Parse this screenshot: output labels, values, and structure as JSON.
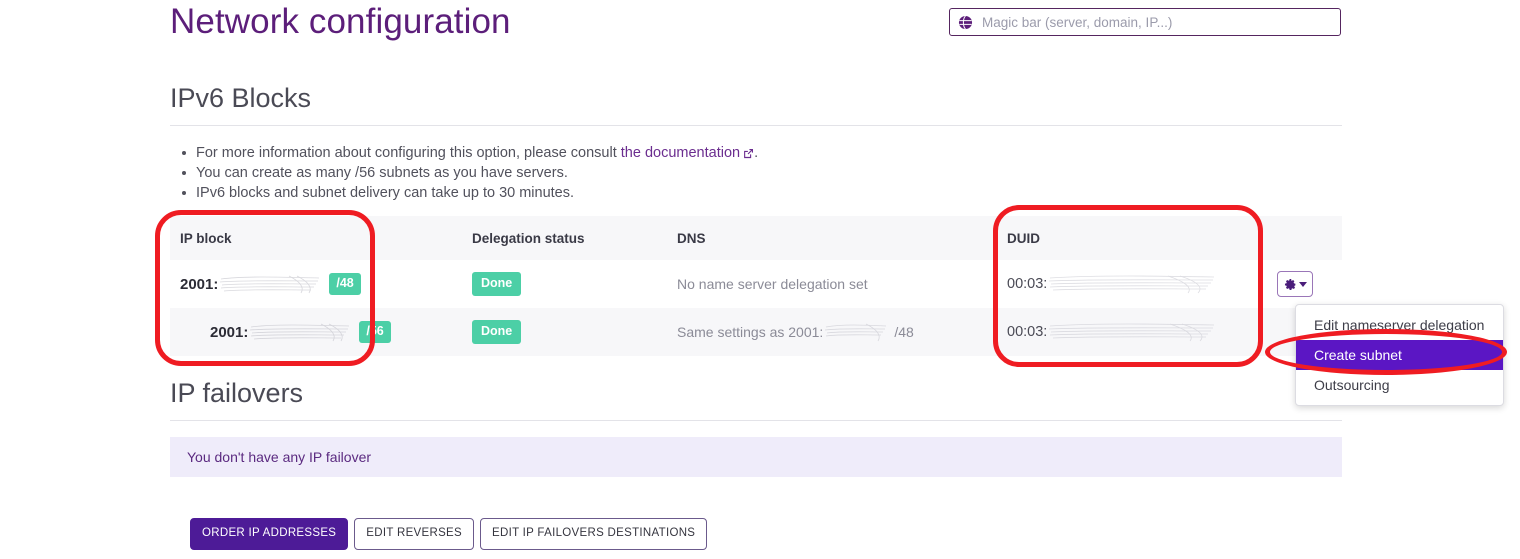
{
  "header": {
    "title": "Network configuration",
    "magicbar": {
      "placeholder": "Magic bar (server, domain, IP...)",
      "value": "",
      "icon": "globe-icon"
    }
  },
  "ipv6_section": {
    "heading": "IPv6 Blocks",
    "bullets": [
      {
        "text_before": "For more information about configuring this option, please consult ",
        "link_text": "the documentation",
        "text_after": "."
      },
      {
        "text_before": "You can create as many /56 subnets as you have servers.",
        "link_text": "",
        "text_after": ""
      },
      {
        "text_before": "IPv6 blocks and subnet delivery can take up to 30 minutes.",
        "link_text": "",
        "text_after": ""
      }
    ],
    "table": {
      "columns": [
        "IP block",
        "Delegation status",
        "DNS",
        "DUID",
        ""
      ],
      "rows": [
        {
          "ip_prefix": "2001:",
          "ip_mask": "/48",
          "status": "Done",
          "dns_prefix": "No name server delegation set",
          "dns_suffix": "",
          "duid_prefix": "00:03:",
          "action_icon": "gear-icon"
        },
        {
          "ip_prefix": "2001:",
          "ip_mask": "/56",
          "status": "Done",
          "dns_prefix": "Same settings as 2001:",
          "dns_suffix": "/48",
          "duid_prefix": "00:03:",
          "action_icon": "gear-icon"
        }
      ]
    },
    "dropdown": {
      "items": [
        {
          "label": "Edit nameserver delegation",
          "active": false
        },
        {
          "label": "Create subnet",
          "active": true
        },
        {
          "label": "Outsourcing",
          "active": false
        }
      ]
    }
  },
  "failover_section": {
    "heading": "IP failovers",
    "empty_message": "You don't have any IP failover"
  },
  "actions": {
    "buttons": [
      {
        "label": "ORDER IP ADDRESSES",
        "style": "primary"
      },
      {
        "label": "EDIT REVERSES",
        "style": "outline"
      },
      {
        "label": "EDIT IP FAILOVERS DESTINATIONS",
        "style": "outline"
      }
    ]
  },
  "colors": {
    "brand_purple": "#4d1b97",
    "title_purple": "#5c1e7a",
    "badge_green": "#4ccfa6",
    "highlight_purple": "#5b16c4",
    "annotation_red": "#ef1c22",
    "banner_bg": "#efecfa"
  }
}
